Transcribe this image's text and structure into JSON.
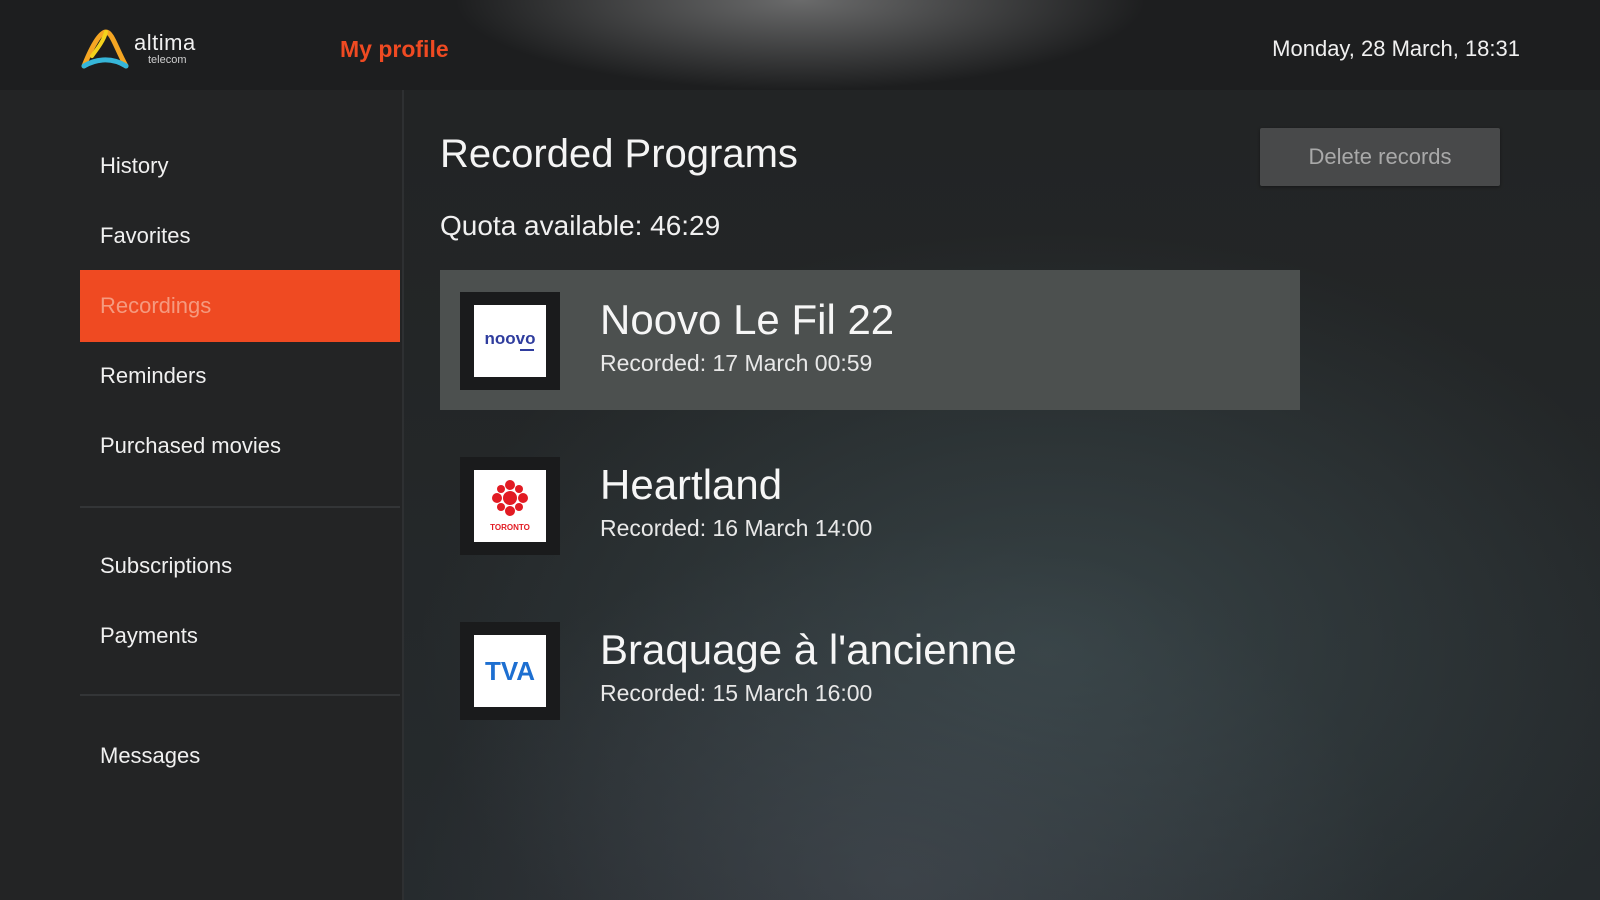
{
  "header": {
    "brand": {
      "name": "altima",
      "sub": "telecom",
      "icon": "altima-logo-icon"
    },
    "page_title": "My profile",
    "datetime": "Monday, 28 March, 18:31"
  },
  "sidebar": {
    "items": [
      {
        "label": "History",
        "active": false
      },
      {
        "label": "Favorites",
        "active": false
      },
      {
        "label": "Recordings",
        "active": true
      },
      {
        "label": "Reminders",
        "active": false
      },
      {
        "label": "Purchased movies",
        "active": false
      },
      {
        "label": "Subscriptions",
        "active": false
      },
      {
        "label": "Payments",
        "active": false
      },
      {
        "label": "Messages",
        "active": false
      }
    ]
  },
  "main": {
    "title": "Recorded Programs",
    "quota": "Quota available: 46:29",
    "delete_label": "Delete records",
    "recordings": [
      {
        "name": "Noovo Le Fil 22",
        "recorded": "Recorded: 17 March 00:59",
        "channel": "noovo",
        "logo_text": "noovo",
        "icon": "noovo-logo-icon"
      },
      {
        "name": "Heartland",
        "recorded": "Recorded: 16 March 14:00",
        "channel": "cbc",
        "logo_text": "TORONTO",
        "icon": "cbc-gem-logo-icon"
      },
      {
        "name": "Braquage à l'ancienne",
        "recorded": "Recorded: 15 March 16:00",
        "channel": "tva",
        "logo_text": "TVA",
        "icon": "tva-logo-icon"
      }
    ]
  },
  "colors": {
    "accent": "#ef4a22",
    "focused_row": "#4c504f",
    "button_bg": "#48494a"
  }
}
